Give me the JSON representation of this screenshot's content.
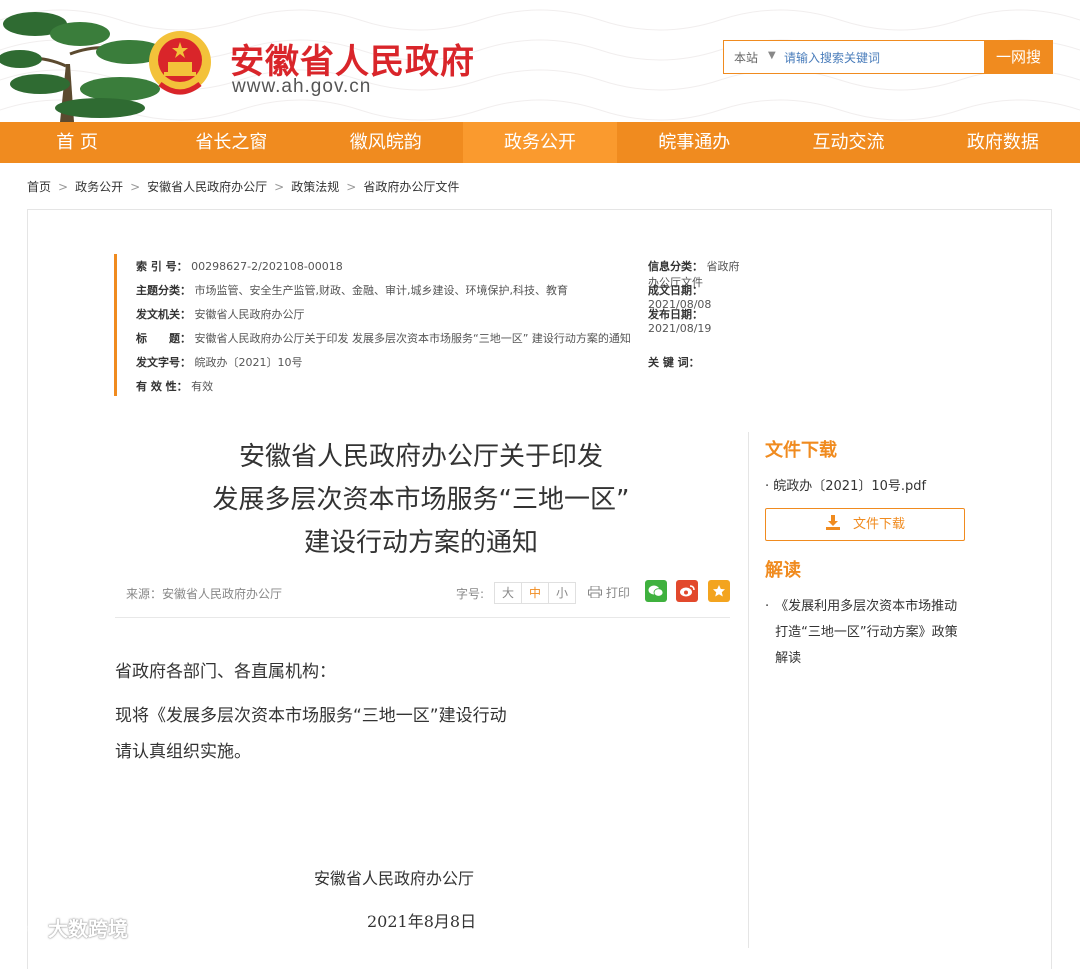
{
  "header": {
    "site_name": "安徽省人民政府",
    "site_url": "www.ah.gov.cn",
    "search_scope": "本站",
    "search_placeholder": "请输入搜索关键词",
    "search_button": "一网搜"
  },
  "nav": [
    "首 页",
    "省长之窗",
    "徽风皖韵",
    "政务公开",
    "皖事通办",
    "互动交流",
    "政府数据"
  ],
  "nav_active_index": 3,
  "breadcrumb": [
    "首页",
    "政务公开",
    "安徽省人民政府办公厅",
    "政策法规",
    "省政府办公厅文件"
  ],
  "meta": {
    "index_k": "索 引 号：",
    "index_v": "00298627-2/202108-00018",
    "category_k": "信息分类：",
    "category_v": "省政府办公厅文件",
    "topic_k": "主题分类：",
    "topic_v": "市场监管、安全生产监管,财政、金融、审计,城乡建设、环境保护,科技、教育",
    "created_k": "成文日期：",
    "created_v": "2021/08/08",
    "org_k": "发文机关：",
    "org_v": "安徽省人民政府办公厅",
    "published_k": "发布日期：",
    "published_v": "2021/08/19",
    "title_k": "标　　题：",
    "title_v": "安徽省人民政府办公厅关于印发 发展多层次资本市场服务“三地一区” 建设行动方案的通知",
    "docno_k": "发文字号：",
    "docno_v": "皖政办〔2021〕10号",
    "keywords_k": "关 键 词：",
    "keywords_v": "",
    "validity_k": "有 效 性：",
    "validity_v": "有效"
  },
  "article": {
    "title_line1": "安徽省人民政府办公厅关于印发",
    "title_line2": "发展多层次资本市场服务“三地一区”",
    "title_line3": "建设行动方案的通知",
    "source": "来源：安徽省人民政府办公厅",
    "font_size_label": "字号:",
    "size_large": "大",
    "size_medium": "中",
    "size_small": "小",
    "print": "打印",
    "para1": "省政府各部门、各直属机构：",
    "para2": "现将《发展多层次资本市场服务“三地一区”建设行动",
    "para3": "请认真组织实施。",
    "signature": "安徽省人民政府办公厅",
    "date": "2021年8月8日"
  },
  "sidebar": {
    "download_heading": "文件下载",
    "file_name": "皖政办〔2021〕10号.pdf",
    "download_button": "文件下载",
    "interpret_heading": "解读",
    "interpret_item": "《发展利用多层次资本市场推动打造“三地一区”行动方案》政策解读"
  },
  "watermark": "大数跨境",
  "colors": {
    "accent": "#f08b1f",
    "brand_red": "#d9252a",
    "wechat": "#3fb13e",
    "weibo": "#e2492c",
    "favorite": "#f3a41f"
  }
}
